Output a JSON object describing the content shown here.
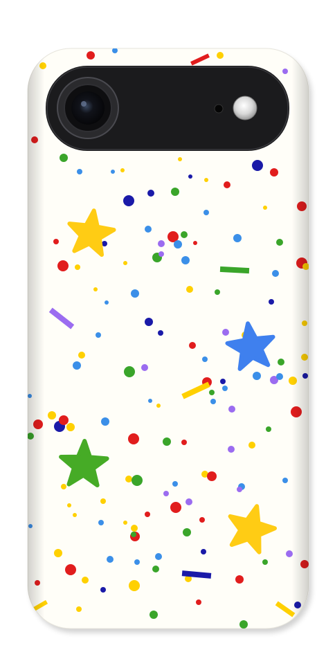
{
  "product": "phone-case",
  "pattern": "confetti",
  "colors": {
    "case_base": "#fffef8",
    "camera_bump": "#1b1b1d",
    "red": "#e11d1d",
    "yellow": "#ffd000",
    "green": "#3aa52a",
    "blue": "#3b8fe8",
    "navy": "#1a1aa8",
    "purple": "#9b6cf0",
    "star_yellow": "#ffcc14",
    "star_blue": "#3f80ee",
    "star_green": "#46ab26"
  }
}
